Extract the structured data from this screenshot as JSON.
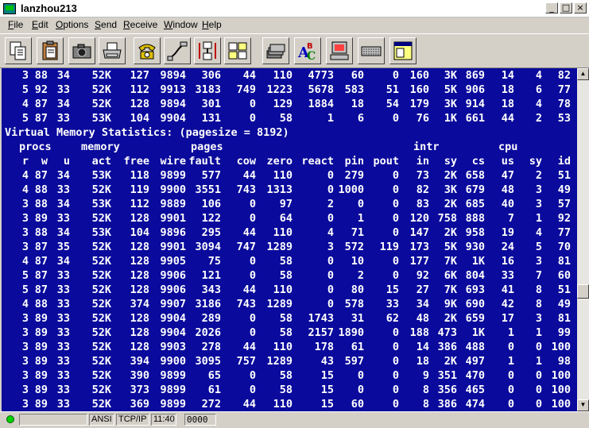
{
  "window": {
    "title": "lanzhou213",
    "minimize_label": "_",
    "maximize_label": "□",
    "close_label": "×"
  },
  "menu": [
    {
      "label": "File",
      "key": "F",
      "rest": "ile"
    },
    {
      "label": "Edit",
      "key": "E",
      "rest": "dit"
    },
    {
      "label": "Options",
      "key": "O",
      "rest": "ptions"
    },
    {
      "label": "Send",
      "key": "S",
      "rest": "end"
    },
    {
      "label": "Receive",
      "key": "R",
      "rest": "eceive"
    },
    {
      "label": "Window",
      "key": "W",
      "rest": "indow"
    },
    {
      "label": "Help",
      "key": "H",
      "rest": "elp"
    }
  ],
  "toolbar": {
    "buttons": [
      "copy-icon",
      "paste-icon",
      "camera-icon",
      "print-icon",
      "phone-icon",
      "cable-icon",
      "connect-icon",
      "layout-icon",
      "stack-icon",
      "spell-icon",
      "computer-icon",
      "keyboard-icon",
      "window-icon"
    ]
  },
  "terminal": {
    "bg_color": "#0a0a9c",
    "fg_color": "#ffffff",
    "top_rows": [
      [
        "3",
        "88",
        "34",
        "52K",
        "127",
        "9894",
        "306",
        "44",
        "110",
        "4773",
        "60",
        "0",
        "160",
        "3K",
        "869",
        "14",
        "4",
        "82"
      ],
      [
        "5",
        "92",
        "33",
        "52K",
        "112",
        "9913",
        "3183",
        "749",
        "1223",
        "5678",
        "583",
        "51",
        "160",
        "5K",
        "906",
        "18",
        "6",
        "77"
      ],
      [
        "4",
        "87",
        "34",
        "52K",
        "128",
        "9894",
        "301",
        "0",
        "129",
        "1884",
        "18",
        "54",
        "179",
        "3K",
        "914",
        "18",
        "4",
        "78"
      ],
      [
        "5",
        "87",
        "33",
        "53K",
        "104",
        "9904",
        "131",
        "0",
        "58",
        "1",
        "6",
        "0",
        "76",
        "1K",
        "661",
        "44",
        "2",
        "53"
      ]
    ],
    "banner": "Virtual Memory Statistics: (pagesize = 8192)",
    "group_header": {
      "procs": "procs",
      "memory": "memory",
      "pages": "pages",
      "intr": "intr",
      "cpu": "cpu"
    },
    "columns": [
      "r",
      "w",
      "u",
      "act",
      "free",
      "wire",
      "fault",
      "cow",
      "zero",
      "react",
      "pin",
      "pout",
      "in",
      "sy",
      "cs",
      "us",
      "sy",
      "id"
    ],
    "rows": [
      [
        "4",
        "87",
        "34",
        "53K",
        "118",
        "9899",
        "577",
        "44",
        "110",
        "0",
        "279",
        "0",
        "73",
        "2K",
        "658",
        "47",
        "2",
        "51"
      ],
      [
        "4",
        "88",
        "33",
        "52K",
        "119",
        "9900",
        "3551",
        "743",
        "1313",
        "0",
        "1000",
        "0",
        "82",
        "3K",
        "679",
        "48",
        "3",
        "49"
      ],
      [
        "3",
        "88",
        "34",
        "53K",
        "112",
        "9889",
        "106",
        "0",
        "97",
        "2",
        "0",
        "0",
        "83",
        "2K",
        "685",
        "40",
        "3",
        "57"
      ],
      [
        "3",
        "89",
        "33",
        "52K",
        "128",
        "9901",
        "122",
        "0",
        "64",
        "0",
        "1",
        "0",
        "120",
        "758",
        "888",
        "7",
        "1",
        "92"
      ],
      [
        "3",
        "88",
        "34",
        "53K",
        "104",
        "9896",
        "295",
        "44",
        "110",
        "4",
        "71",
        "0",
        "147",
        "2K",
        "958",
        "19",
        "4",
        "77"
      ],
      [
        "3",
        "87",
        "35",
        "52K",
        "128",
        "9901",
        "3094",
        "747",
        "1289",
        "3",
        "572",
        "119",
        "173",
        "5K",
        "930",
        "24",
        "5",
        "70"
      ],
      [
        "4",
        "87",
        "34",
        "52K",
        "128",
        "9905",
        "75",
        "0",
        "58",
        "0",
        "10",
        "0",
        "177",
        "7K",
        "1K",
        "16",
        "3",
        "81"
      ],
      [
        "5",
        "87",
        "33",
        "52K",
        "128",
        "9906",
        "121",
        "0",
        "58",
        "0",
        "2",
        "0",
        "92",
        "6K",
        "804",
        "33",
        "7",
        "60"
      ],
      [
        "5",
        "87",
        "33",
        "52K",
        "128",
        "9906",
        "343",
        "44",
        "110",
        "0",
        "80",
        "15",
        "27",
        "7K",
        "693",
        "41",
        "8",
        "51"
      ],
      [
        "4",
        "88",
        "33",
        "52K",
        "374",
        "9907",
        "3186",
        "743",
        "1289",
        "0",
        "578",
        "33",
        "34",
        "9K",
        "690",
        "42",
        "8",
        "49"
      ],
      [
        "3",
        "89",
        "33",
        "52K",
        "128",
        "9904",
        "289",
        "0",
        "58",
        "1743",
        "31",
        "62",
        "48",
        "2K",
        "659",
        "17",
        "3",
        "81"
      ],
      [
        "3",
        "89",
        "33",
        "52K",
        "128",
        "9904",
        "2026",
        "0",
        "58",
        "2157",
        "1890",
        "0",
        "188",
        "473",
        "1K",
        "1",
        "1",
        "99"
      ],
      [
        "3",
        "89",
        "33",
        "52K",
        "128",
        "9903",
        "278",
        "44",
        "110",
        "178",
        "61",
        "0",
        "14",
        "386",
        "488",
        "0",
        "0",
        "100"
      ],
      [
        "3",
        "89",
        "33",
        "52K",
        "394",
        "9900",
        "3095",
        "757",
        "1289",
        "43",
        "597",
        "0",
        "18",
        "2K",
        "497",
        "1",
        "1",
        "98"
      ],
      [
        "3",
        "89",
        "33",
        "52K",
        "390",
        "9899",
        "65",
        "0",
        "58",
        "15",
        "0",
        "0",
        "9",
        "351",
        "470",
        "0",
        "0",
        "100"
      ],
      [
        "3",
        "89",
        "33",
        "52K",
        "373",
        "9899",
        "61",
        "0",
        "58",
        "15",
        "0",
        "0",
        "8",
        "356",
        "465",
        "0",
        "0",
        "100"
      ],
      [
        "3",
        "89",
        "33",
        "52K",
        "369",
        "9899",
        "272",
        "44",
        "110",
        "15",
        "60",
        "0",
        "8",
        "386",
        "474",
        "0",
        "0",
        "100"
      ]
    ]
  },
  "status": {
    "encoding": "ANSI",
    "protocol": "TCP/IP",
    "time": "11:40",
    "indicator": "0000"
  }
}
